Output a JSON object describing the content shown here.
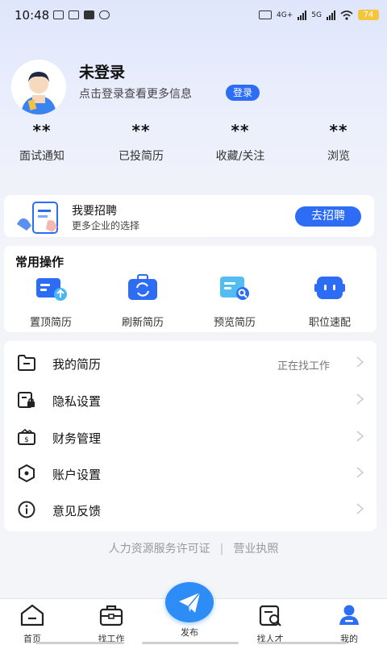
{
  "status_bar": {
    "time": "10:48",
    "network": "4G+",
    "network2": "5G",
    "battery": "74"
  },
  "profile": {
    "title": "未登录",
    "hint": "点击登录查看更多信息",
    "login_button": "登录"
  },
  "stats": [
    {
      "value": "**",
      "label": "面试通知"
    },
    {
      "value": "**",
      "label": "已投简历"
    },
    {
      "value": "**",
      "label": "收藏/关注"
    },
    {
      "value": "**",
      "label": "浏览"
    }
  ],
  "recruit": {
    "title": "我要招聘",
    "subtitle": "更多企业的选择",
    "button": "去招聘"
  },
  "ops": {
    "title": "常用操作",
    "items": [
      {
        "label": "置顶简历",
        "icon": "pin-resume-icon"
      },
      {
        "label": "刷新简历",
        "icon": "refresh-resume-icon"
      },
      {
        "label": "预览简历",
        "icon": "preview-resume-icon"
      },
      {
        "label": "职位速配",
        "icon": "job-match-icon"
      }
    ]
  },
  "menu": [
    {
      "label": "我的简历",
      "value": "正在找工作",
      "icon": "folder-icon"
    },
    {
      "label": "隐私设置",
      "value": "",
      "icon": "privacy-lock-icon"
    },
    {
      "label": "财务管理",
      "value": "",
      "icon": "wallet-icon"
    },
    {
      "label": "账户设置",
      "value": "",
      "icon": "account-settings-icon"
    },
    {
      "label": "意见反馈",
      "value": "",
      "icon": "info-icon"
    }
  ],
  "footer": {
    "license": "人力资源服务许可证",
    "separator": "|",
    "business": "营业执照"
  },
  "tabbar": {
    "items": [
      {
        "label": "首页",
        "icon": "home-icon"
      },
      {
        "label": "找工作",
        "icon": "briefcase-icon"
      },
      {
        "label": "发布",
        "icon": "paper-plane-icon"
      },
      {
        "label": "找人才",
        "icon": "find-talent-icon"
      },
      {
        "label": "我的",
        "icon": "user-icon"
      }
    ]
  },
  "colors": {
    "accent": "#2d6df6",
    "publish": "#2d8cf6",
    "active_tab": "#2d6df6"
  }
}
